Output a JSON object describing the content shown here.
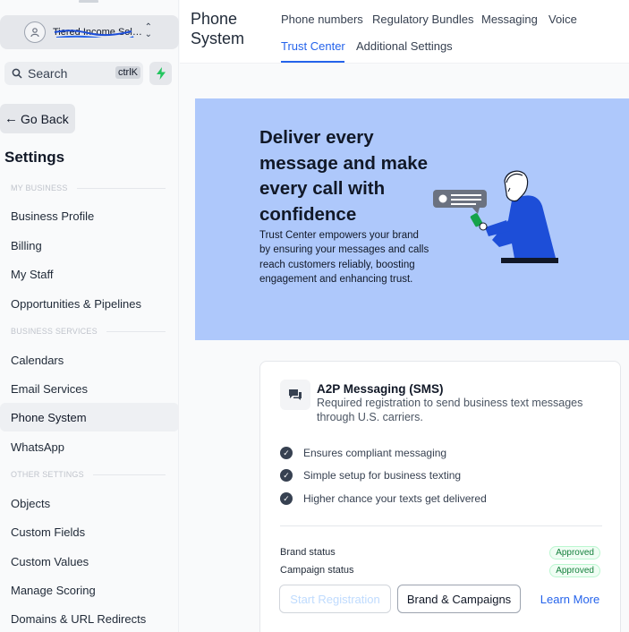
{
  "sidebar": {
    "account_name": "Tiered Income Soli...",
    "search_label": "Search",
    "search_shortcut": "ctrlK",
    "go_back": "Go Back",
    "settings_title": "Settings",
    "sections": [
      {
        "heading": "MY BUSINESS",
        "items": [
          "Business Profile",
          "Billing",
          "My Staff",
          "Opportunities & Pipelines"
        ]
      },
      {
        "heading": "BUSINESS SERVICES",
        "items": [
          "Calendars",
          "Email Services",
          "Phone System",
          "WhatsApp"
        ]
      },
      {
        "heading": "OTHER SETTINGS",
        "items": [
          "Objects",
          "Custom Fields",
          "Custom Values",
          "Manage Scoring",
          "Domains & URL Redirects"
        ]
      }
    ],
    "active_item": "Phone System"
  },
  "header": {
    "title": "Phone System",
    "tabs": [
      "Phone numbers",
      "Regulatory Bundles",
      "Messaging",
      "Voice",
      "Trust Center",
      "Additional Settings"
    ],
    "active_tab": "Trust Center"
  },
  "banner": {
    "headline": "Deliver every message and make every call with confidence",
    "body": "Trust Center empowers your brand by ensuring your messages and calls reach customers reliably, boosting engagement and enhancing trust."
  },
  "card": {
    "title": "A2P Messaging (SMS)",
    "description": "Required registration to send business text messages through U.S. carriers.",
    "features": [
      "Ensures compliant messaging",
      "Simple setup for business texting",
      "Higher chance your texts get delivered"
    ],
    "statuses": [
      {
        "label": "Brand status",
        "value": "Approved"
      },
      {
        "label": "Campaign status",
        "value": "Approved"
      }
    ],
    "buttons": {
      "start": "Start Registration",
      "brand": "Brand & Campaigns",
      "learn": "Learn More"
    }
  },
  "colors": {
    "accent": "#2563eb",
    "banner_bg": "#aec8fb",
    "approved": "#15803d"
  }
}
